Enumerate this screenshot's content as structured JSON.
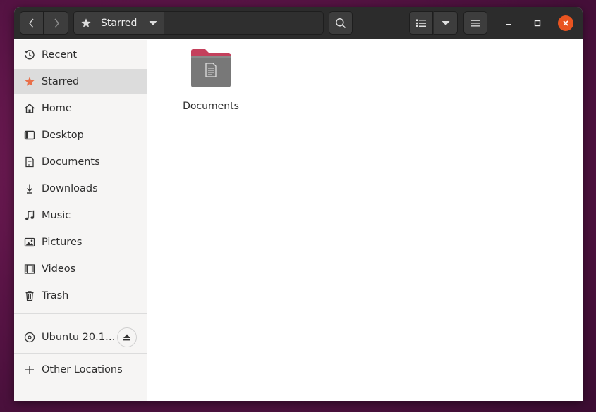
{
  "headerbar": {
    "path_label": "Starred",
    "icons": {
      "back": "chevron-left-icon",
      "forward": "chevron-right-icon",
      "path": "star-icon",
      "path_dropdown": "triangle-down-icon",
      "search": "search-icon",
      "view_list": "list-view-icon",
      "view_options": "triangle-down-icon",
      "menu": "hamburger-menu-icon",
      "minimize": "minimize-icon",
      "maximize": "maximize-icon",
      "close": "close-icon"
    }
  },
  "sidebar": {
    "items": [
      {
        "label": "Recent",
        "icon": "clock-icon"
      },
      {
        "label": "Starred",
        "icon": "star-icon",
        "active": true
      },
      {
        "label": "Home",
        "icon": "home-icon"
      },
      {
        "label": "Desktop",
        "icon": "desktop-icon"
      },
      {
        "label": "Documents",
        "icon": "document-icon"
      },
      {
        "label": "Downloads",
        "icon": "download-icon"
      },
      {
        "label": "Music",
        "icon": "music-note-icon"
      },
      {
        "label": "Pictures",
        "icon": "picture-icon"
      },
      {
        "label": "Videos",
        "icon": "film-icon"
      },
      {
        "label": "Trash",
        "icon": "trash-icon"
      }
    ],
    "device": {
      "label": "Ubuntu 20.1…",
      "icon": "disc-icon",
      "eject_icon": "eject-icon"
    },
    "other_locations": {
      "label": "Other Locations",
      "icon": "plus-icon"
    }
  },
  "content": {
    "files": [
      {
        "name": "Documents",
        "icon": "folder-documents-icon"
      }
    ]
  },
  "colors": {
    "accent": "#e95420",
    "starred": "#e9704a",
    "folder_top": "#c4405c",
    "folder_body": "#787878",
    "headerbar": "#2c2c2c"
  }
}
